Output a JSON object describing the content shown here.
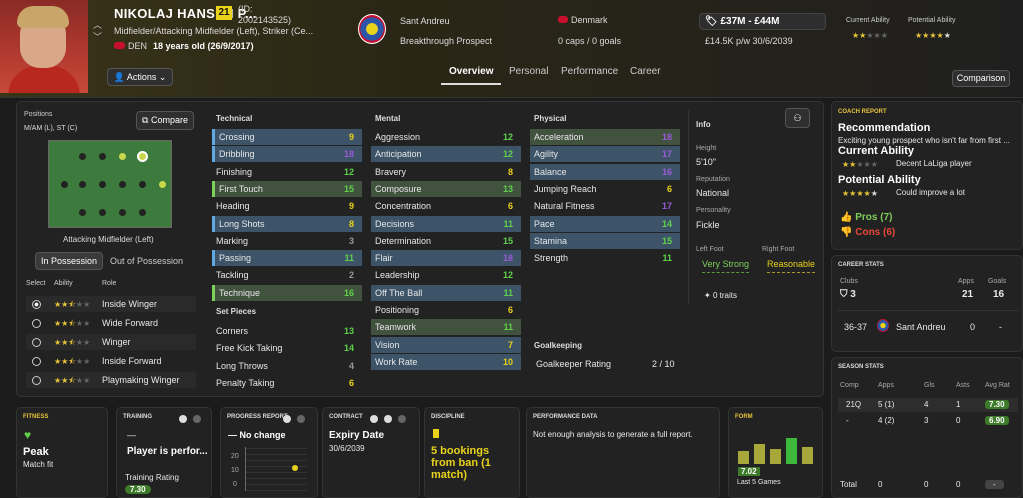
{
  "player": {
    "name": "NIKOLAJ HANSEN P...",
    "number": "21",
    "id_label": "(ID:",
    "id": "2002143525)",
    "positions": "Midfielder/Attacking Midfielder (Left), Striker (Ce...",
    "nation_code": "DEN",
    "age": "18 years old (26/9/2017)"
  },
  "club": {
    "name": "Sant Andreu",
    "status": "Breakthrough Prospect"
  },
  "nation": {
    "name": "Denmark",
    "caps": "0 caps / 0 goals"
  },
  "value": {
    "range": "£37M - £44M",
    "wage": "£14.5K p/w 30/6/2039"
  },
  "ability": {
    "ca_label": "Current Ability",
    "pa_label": "Potential Ability",
    "ca_stars": 2,
    "pa_stars": 4.5
  },
  "actions_label": "Actions",
  "tabs": [
    "Overview",
    "Personal",
    "Performance",
    "Career"
  ],
  "comparison_label": "Comparison",
  "positions_panel": {
    "title": "Positions",
    "value": "M/AM (L), ST (C)",
    "compare_label": "Compare",
    "role_name": "Attacking Midfielder (Left)",
    "in_possession": "In Possession",
    "out_possession": "Out of Possession",
    "select_label": "Select",
    "ability_label": "Ability",
    "role_label": "Role",
    "roles": [
      {
        "name": "Inside Winger",
        "stars": 2.5,
        "selected": true
      },
      {
        "name": "Wide Forward",
        "stars": 2.5,
        "selected": false
      },
      {
        "name": "Winger",
        "stars": 2.5,
        "selected": false
      },
      {
        "name": "Inside Forward",
        "stars": 2.5,
        "selected": false
      },
      {
        "name": "Playmaking Winger",
        "stars": 2.5,
        "selected": false
      }
    ]
  },
  "technical": {
    "title": "Technical",
    "items": [
      {
        "name": "Crossing",
        "value": "9",
        "color": "yellow",
        "hl": "blue",
        "bar": "blue"
      },
      {
        "name": "Dribbling",
        "value": "18",
        "color": "purple",
        "hl": "blue",
        "bar": "blue"
      },
      {
        "name": "Finishing",
        "value": "12",
        "color": "green",
        "hl": "",
        "bar": ""
      },
      {
        "name": "First Touch",
        "value": "15",
        "color": "green",
        "hl": "green",
        "bar": "green"
      },
      {
        "name": "Heading",
        "value": "9",
        "color": "yellow",
        "hl": "",
        "bar": ""
      },
      {
        "name": "Long Shots",
        "value": "8",
        "color": "yellow",
        "hl": "blue",
        "bar": "blue"
      },
      {
        "name": "Marking",
        "value": "3",
        "color": "grey",
        "hl": "",
        "bar": ""
      },
      {
        "name": "Passing",
        "value": "11",
        "color": "green",
        "hl": "blue",
        "bar": "blue"
      },
      {
        "name": "Tackling",
        "value": "2",
        "color": "grey",
        "hl": "",
        "bar": ""
      },
      {
        "name": "Technique",
        "value": "16",
        "color": "green",
        "hl": "green",
        "bar": "green"
      }
    ]
  },
  "set_pieces": {
    "title": "Set Pieces",
    "items": [
      {
        "name": "Corners",
        "value": "13",
        "color": "green"
      },
      {
        "name": "Free Kick Taking",
        "value": "14",
        "color": "green"
      },
      {
        "name": "Long Throws",
        "value": "4",
        "color": "grey"
      },
      {
        "name": "Penalty Taking",
        "value": "6",
        "color": "yellow"
      }
    ]
  },
  "mental": {
    "title": "Mental",
    "items": [
      {
        "name": "Aggression",
        "value": "12",
        "color": "green",
        "hl": ""
      },
      {
        "name": "Anticipation",
        "value": "12",
        "color": "green",
        "hl": "blue"
      },
      {
        "name": "Bravery",
        "value": "8",
        "color": "yellow",
        "hl": ""
      },
      {
        "name": "Composure",
        "value": "13",
        "color": "green",
        "hl": "green"
      },
      {
        "name": "Concentration",
        "value": "6",
        "color": "yellow",
        "hl": ""
      },
      {
        "name": "Decisions",
        "value": "11",
        "color": "green",
        "hl": "blue"
      },
      {
        "name": "Determination",
        "value": "15",
        "color": "green",
        "hl": ""
      },
      {
        "name": "Flair",
        "value": "18",
        "color": "purple",
        "hl": "blue"
      },
      {
        "name": "Leadership",
        "value": "12",
        "color": "green",
        "hl": ""
      },
      {
        "name": "Off The Ball",
        "value": "11",
        "color": "green",
        "hl": "blue"
      },
      {
        "name": "Positioning",
        "value": "6",
        "color": "yellow",
        "hl": ""
      },
      {
        "name": "Teamwork",
        "value": "11",
        "color": "green",
        "hl": "green"
      },
      {
        "name": "Vision",
        "value": "7",
        "color": "yellow",
        "hl": "blue"
      },
      {
        "name": "Work Rate",
        "value": "10",
        "color": "yellow",
        "hl": "blue"
      }
    ]
  },
  "physical": {
    "title": "Physical",
    "items": [
      {
        "name": "Acceleration",
        "value": "18",
        "color": "purple",
        "hl": "green"
      },
      {
        "name": "Agility",
        "value": "17",
        "color": "purple",
        "hl": "blue"
      },
      {
        "name": "Balance",
        "value": "16",
        "color": "purple",
        "hl": "blue"
      },
      {
        "name": "Jumping Reach",
        "value": "6",
        "color": "yellow",
        "hl": ""
      },
      {
        "name": "Natural Fitness",
        "value": "17",
        "color": "purple",
        "hl": ""
      },
      {
        "name": "Pace",
        "value": "14",
        "color": "green",
        "hl": "blue"
      },
      {
        "name": "Stamina",
        "value": "15",
        "color": "green",
        "hl": "blue"
      },
      {
        "name": "Strength",
        "value": "11",
        "color": "green",
        "hl": ""
      }
    ]
  },
  "goalkeeping": {
    "title": "Goalkeeping",
    "label": "Goalkeeper Rating",
    "value": "2 / 10"
  },
  "info": {
    "title": "Info",
    "height_label": "Height",
    "height": "5'10\"",
    "rep_label": "Reputation",
    "rep": "National",
    "pers_label": "Personality",
    "pers": "Fickle",
    "lf_label": "Left Foot",
    "lf": "Very Strong",
    "rf_label": "Right Foot",
    "rf": "Reasonable",
    "traits": "0 traits"
  },
  "coach": {
    "title": "COACH REPORT",
    "rec_title": "Recommendation",
    "rec_text": "Exciting young prospect who isn't far from first ...",
    "ca_title": "Current Ability",
    "ca_text": "Decent LaLiga player",
    "pa_title": "Potential Ability",
    "pa_text": "Could improve a lot",
    "pros": "Pros (7)",
    "cons": "Cons (6)"
  },
  "career": {
    "title": "CAREER STATS",
    "clubs_label": "Clubs",
    "apps_label": "Apps",
    "goals_label": "Goals",
    "clubs": "3",
    "apps": "21",
    "goals": "16",
    "season": "36-37",
    "club": "Sant Andreu",
    "s_apps": "0",
    "s_goals": "-"
  },
  "season": {
    "title": "SEASON STATS",
    "headers": [
      "Comp",
      "Apps",
      "Gls",
      "Asts",
      "Avg Rat"
    ],
    "rows": [
      [
        "21Q",
        "5 (1)",
        "4",
        "1",
        "7.30"
      ],
      [
        "-",
        "4 (2)",
        "3",
        "0",
        "6.90"
      ]
    ],
    "total": [
      "Total",
      "0",
      "0",
      "0",
      "-"
    ]
  },
  "bottom": {
    "fitness": {
      "title": "FITNESS",
      "value": "Peak",
      "sub": "Match fit"
    },
    "training": {
      "title": "TRAINING",
      "dash": "—",
      "text": "Player is perfor...",
      "rating_label": "Training Rating",
      "rating": "7.30"
    },
    "progress": {
      "title": "PROGRESS REPORT",
      "text": "No change",
      "ticks": [
        "20",
        "10",
        "0"
      ]
    },
    "contract": {
      "title": "CONTRACT",
      "label": "Expiry Date",
      "date": "30/6/2039"
    },
    "discipline": {
      "title": "DISCIPLINE",
      "text": "5 bookings from ban (1 match)"
    },
    "performance": {
      "title": "PERFORMANCE DATA",
      "text": "Not enough analysis to generate a full report."
    },
    "form": {
      "title": "FORM",
      "avg": "7.02",
      "label": "Last 5 Games",
      "values": [
        6.5,
        7.4,
        6.8,
        8.1,
        7.0
      ]
    }
  }
}
